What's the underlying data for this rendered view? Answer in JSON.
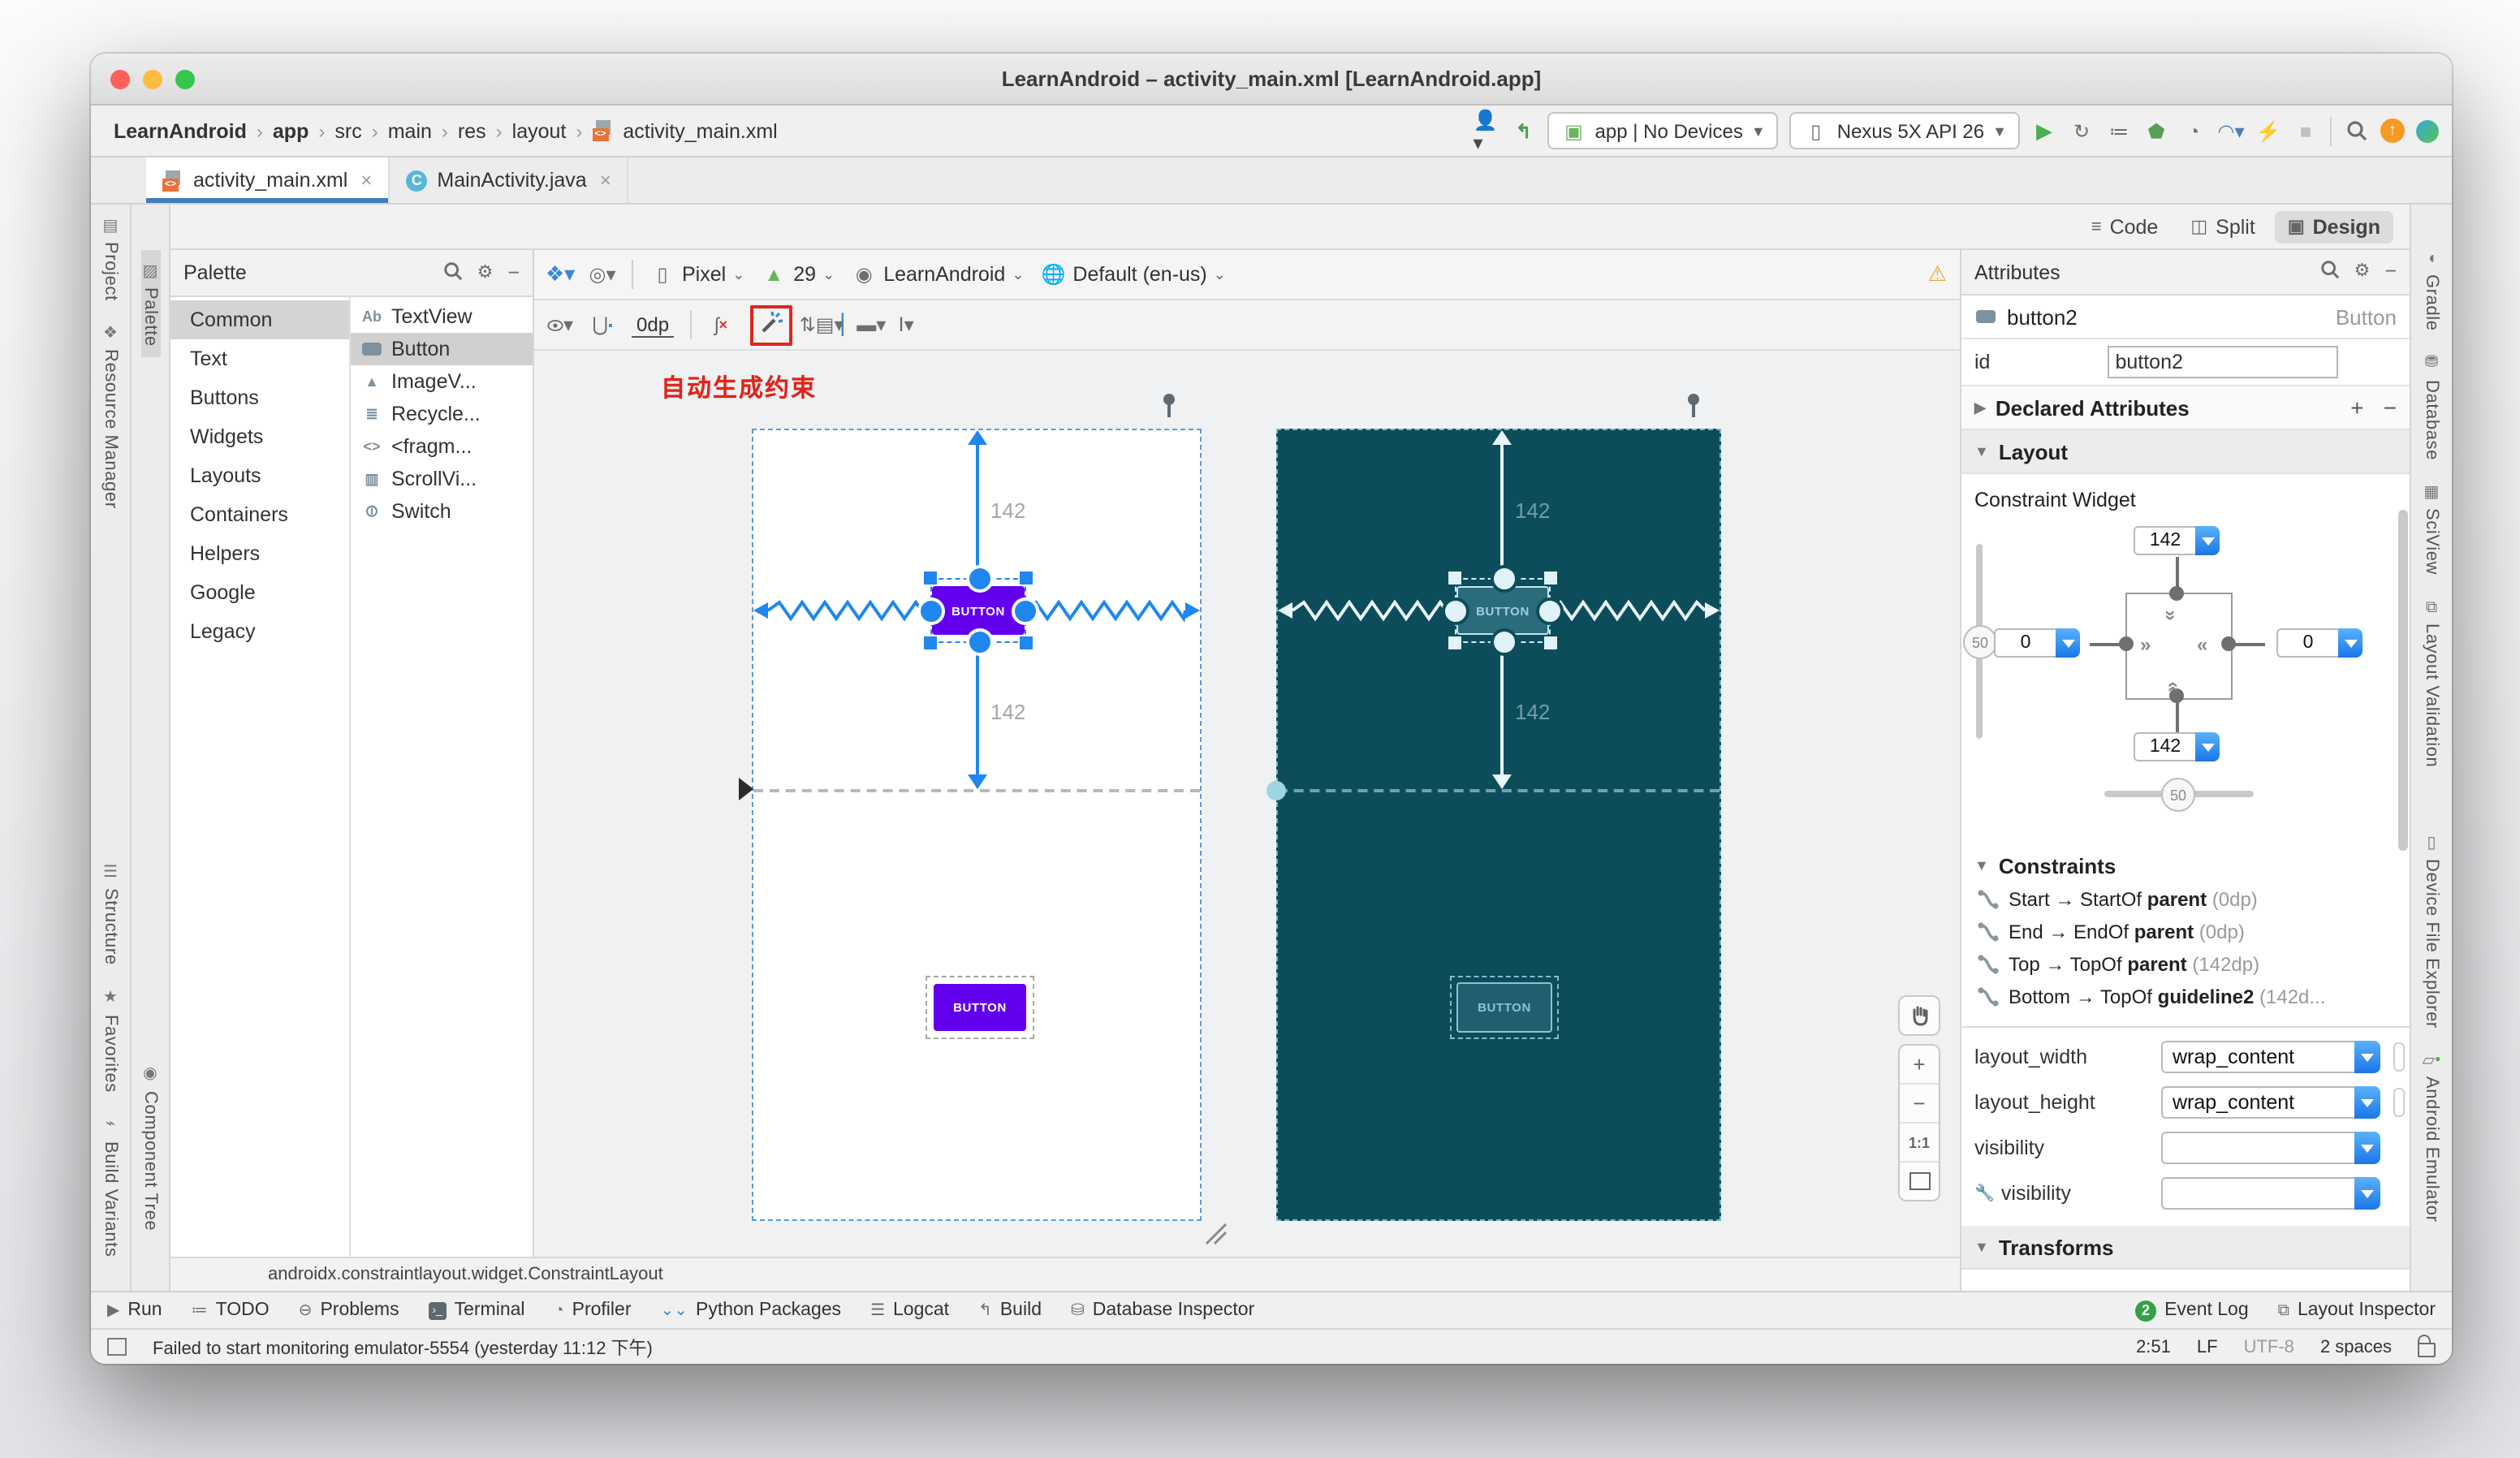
{
  "window": {
    "title": "LearnAndroid – activity_main.xml [LearnAndroid.app]"
  },
  "toolbar": {
    "breadcrumbs": [
      "LearnAndroid",
      "app",
      "src",
      "main",
      "res",
      "layout",
      "activity_main.xml"
    ],
    "run_config": "app | No Devices",
    "device": "Nexus 5X API 26"
  },
  "tabs": {
    "tab1": "activity_main.xml",
    "tab2": "MainActivity.java"
  },
  "mode_bar": {
    "code": "Code",
    "split": "Split",
    "design": "Design"
  },
  "left_strip": {
    "project": "Project",
    "resource_manager": "Resource Manager",
    "structure": "Structure",
    "favorites": "Favorites",
    "build_variants": "Build Variants"
  },
  "inner_strip": {
    "palette": "Palette",
    "component_tree": "Component Tree"
  },
  "palette": {
    "title": "Palette",
    "categories": [
      "Common",
      "Text",
      "Buttons",
      "Widgets",
      "Layouts",
      "Containers",
      "Helpers",
      "Google",
      "Legacy"
    ],
    "components": [
      "TextView",
      "Button",
      "ImageV...",
      "Recycle...",
      "<fragm...",
      "ScrollVi...",
      "Switch"
    ]
  },
  "design_toolbar": {
    "device": "Pixel",
    "api": "29",
    "theme": "LearnAndroid",
    "locale": "Default (en-us)",
    "margin": "0dp"
  },
  "annotation": {
    "text": "自动生成约束"
  },
  "canvas": {
    "margin_top": "142",
    "margin_bottom": "142",
    "button_label": "BUTTON",
    "zoom_ratio": "1:1",
    "breadcrumb": "androidx.constraintlayout.widget.ConstraintLayout"
  },
  "attributes": {
    "title": "Attributes",
    "component_name": "button2",
    "component_type": "Button",
    "id_label": "id",
    "id_value": "button2",
    "declared": "Declared Attributes",
    "layout": "Layout",
    "constraint_widget": "Constraint Widget",
    "widget": {
      "top": "142",
      "bottom": "142",
      "start": "0",
      "end": "0",
      "vbias": "50",
      "hbias": "50"
    },
    "constraints_title": "Constraints",
    "constraints": [
      {
        "pre": "Start → StartOf ",
        "target": "parent",
        "post": " (0dp)"
      },
      {
        "pre": "End → EndOf ",
        "target": "parent",
        "post": " (0dp)"
      },
      {
        "pre": "Top → TopOf ",
        "target": "parent",
        "post": " (142dp)"
      },
      {
        "pre": "Bottom → TopOf ",
        "target": "guideline2",
        "post": " (142d..."
      }
    ],
    "fields": [
      {
        "label": "layout_width",
        "value": "wrap_content"
      },
      {
        "label": "layout_height",
        "value": "wrap_content"
      },
      {
        "label": "visibility",
        "value": ""
      },
      {
        "label": "visibility",
        "value": ""
      }
    ],
    "transforms": "Transforms"
  },
  "right_strip": [
    "Gradle",
    "Database",
    "SciView",
    "Layout Validation",
    "Device File Explorer",
    "Android Emulator"
  ],
  "bottom_bar": {
    "items": [
      "Run",
      "TODO",
      "Problems",
      "Terminal",
      "Profiler",
      "Python Packages",
      "Logcat",
      "Build",
      "Database Inspector"
    ],
    "event_badge": "2",
    "event_log": "Event Log",
    "layout_inspector": "Layout Inspector"
  },
  "status_bar": {
    "message": "Failed to start monitoring emulator-5554 (yesterday 11:12 下午)",
    "position": "2:51",
    "line_sep": "LF",
    "encoding": "UTF-8",
    "indent": "2 spaces"
  },
  "colors": {
    "accent_blue": "#1f87ee",
    "material_purple": "#6200ee",
    "blueprint_bg": "#0d4d5b",
    "annotation_red": "#e0251b",
    "tab_underline": "#3d7dbf",
    "warning_orange": "#f0a732",
    "event_green": "#35a146",
    "update_orange": "#f59b22"
  }
}
